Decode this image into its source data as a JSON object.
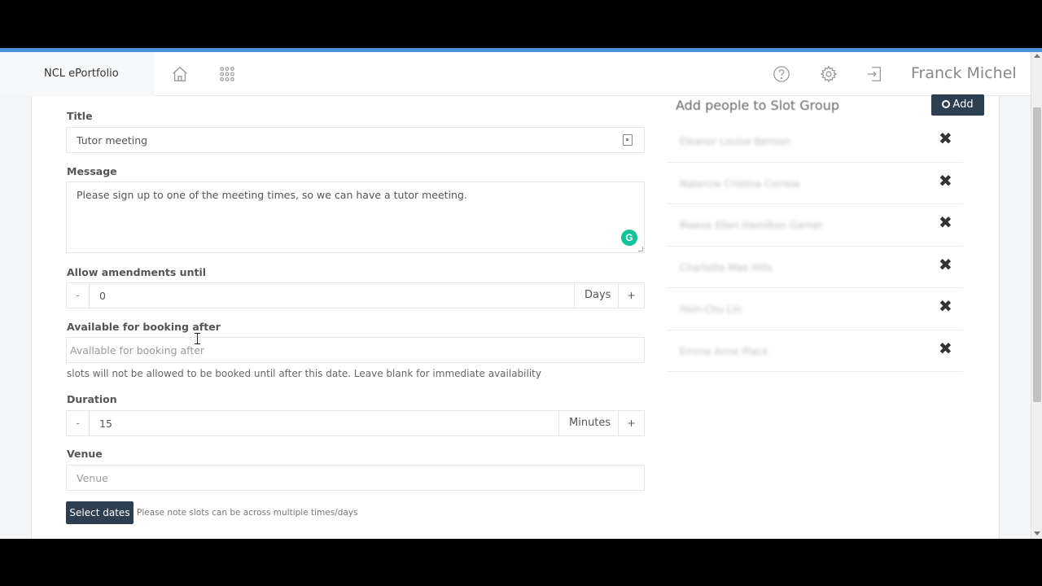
{
  "app": {
    "brand": "NCL ePortfolio",
    "user_name": "Franck Michel"
  },
  "nav_icons": [
    "home-icon",
    "apps-grid-icon",
    "help-icon",
    "settings-icon",
    "logout-icon"
  ],
  "form": {
    "title_label": "Title",
    "title_value": "Tutor meeting",
    "message_label": "Message",
    "message_value": "Please sign up to one of the meeting times, so we can have a tutor meeting.",
    "amend_label": "Allow amendments until",
    "amend_minus": "-",
    "amend_value": "0",
    "amend_unit": "Days",
    "amend_plus": "+",
    "booking_label": "Available for booking after",
    "booking_placeholder": "Available for booking after",
    "booking_help": "slots will not be allowed to be booked until after this date. Leave blank for immediate availability",
    "duration_label": "Duration",
    "duration_minus": "-",
    "duration_value": "15",
    "duration_unit": "Minutes",
    "duration_plus": "+",
    "venue_label": "Venue",
    "venue_placeholder": "Venue",
    "select_dates_label": "Select dates",
    "select_dates_note": "Please note slots can be across multiple times/days"
  },
  "slot_group": {
    "title": "Add people to Slot Group",
    "add_button": "Add",
    "remove_symbol": "✖",
    "people": [
      "Eleanor Louise Benson",
      "Natercia Cristina Correia",
      "Maeve Ellen Hamilton Garner",
      "Charlotte Mae Hills",
      "Hsin-Chu Lin",
      "Emma Anne Place"
    ]
  },
  "colors": {
    "accent_bar": "#4a90d9",
    "button_dark": "#2c3e50",
    "grammarly": "#15c39a"
  }
}
